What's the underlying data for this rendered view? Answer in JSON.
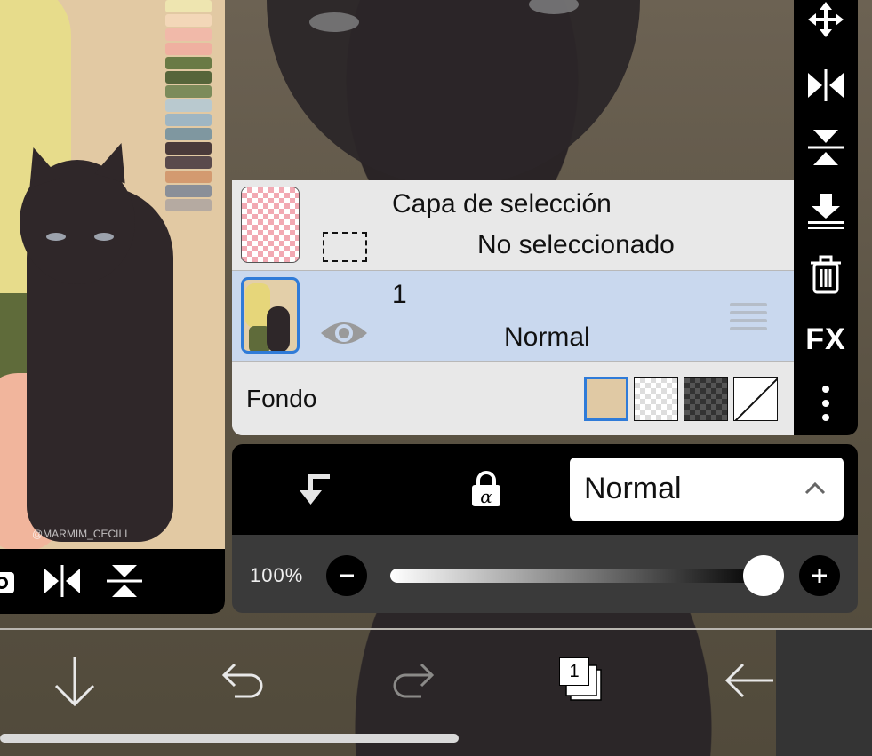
{
  "layers_panel": {
    "selection_layer": {
      "title": "Capa de selección",
      "status": "No seleccionado"
    },
    "layer_1": {
      "name": "1",
      "blend_mode": "Normal"
    },
    "background": {
      "label": "Fondo",
      "options": [
        "tan",
        "light-checker",
        "dark-checker",
        "none"
      ],
      "selected": "tan",
      "selected_color": "#e0c9a4"
    }
  },
  "blend_bar": {
    "mode_value": "Normal",
    "clip_icon": "clip-arrow-icon",
    "lock_icon": "alpha-lock-icon"
  },
  "opacity": {
    "label": "100%",
    "value": 100
  },
  "right_toolbar": {
    "fx_label": "FX",
    "icons": [
      "move-icon",
      "flip-horizontal-icon",
      "flip-vertical-icon",
      "merge-down-icon",
      "trash-icon",
      "fx-icon",
      "more-vertical-icon"
    ]
  },
  "preview": {
    "credit": "@MARMIM_CECILL",
    "tools": [
      "camera-icon",
      "flip-horizontal-icon",
      "flip-vertical-icon"
    ],
    "palette": [
      "#eee5b0",
      "#f3d7b8",
      "#f1b9a9",
      "#efb0a0",
      "#6a7a45",
      "#56653a",
      "#7c8b5a",
      "#b9c9cf",
      "#9fb6c3",
      "#7f97a0",
      "#4a3a3a",
      "#5a4a4c",
      "#d39a70",
      "#8a8f98",
      "#b5aaa1"
    ]
  },
  "bottom_nav": {
    "layer_count": "1",
    "icons": [
      "download-arrow-icon",
      "undo-icon",
      "redo-icon",
      "layers-icon",
      "back-arrow-icon"
    ]
  },
  "colors": {
    "accent_blue": "#2f7bd8",
    "selected_row": "#c9d8ee",
    "panel_bg": "#e8e8e8"
  }
}
